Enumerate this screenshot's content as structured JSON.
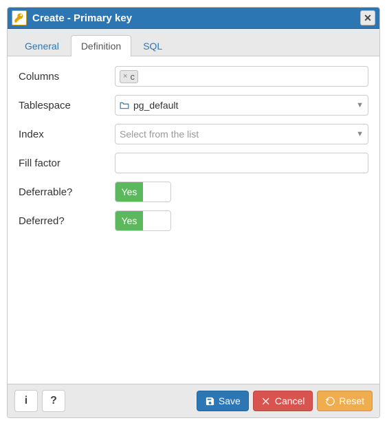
{
  "title": "Create - Primary key",
  "tabs": {
    "general": "General",
    "definition": "Definition",
    "sql": "SQL",
    "active": "definition"
  },
  "fields": {
    "columns_label": "Columns",
    "columns_chip": "c",
    "tablespace_label": "Tablespace",
    "tablespace_value": "pg_default",
    "index_label": "Index",
    "index_placeholder": "Select from the list",
    "fillfactor_label": "Fill factor",
    "fillfactor_value": "",
    "deferrable_label": "Deferrable?",
    "deferrable_value": "Yes",
    "deferred_label": "Deferred?",
    "deferred_value": "Yes"
  },
  "footer": {
    "info": "i",
    "help": "?",
    "save": "Save",
    "cancel": "Cancel",
    "reset": "Reset"
  }
}
